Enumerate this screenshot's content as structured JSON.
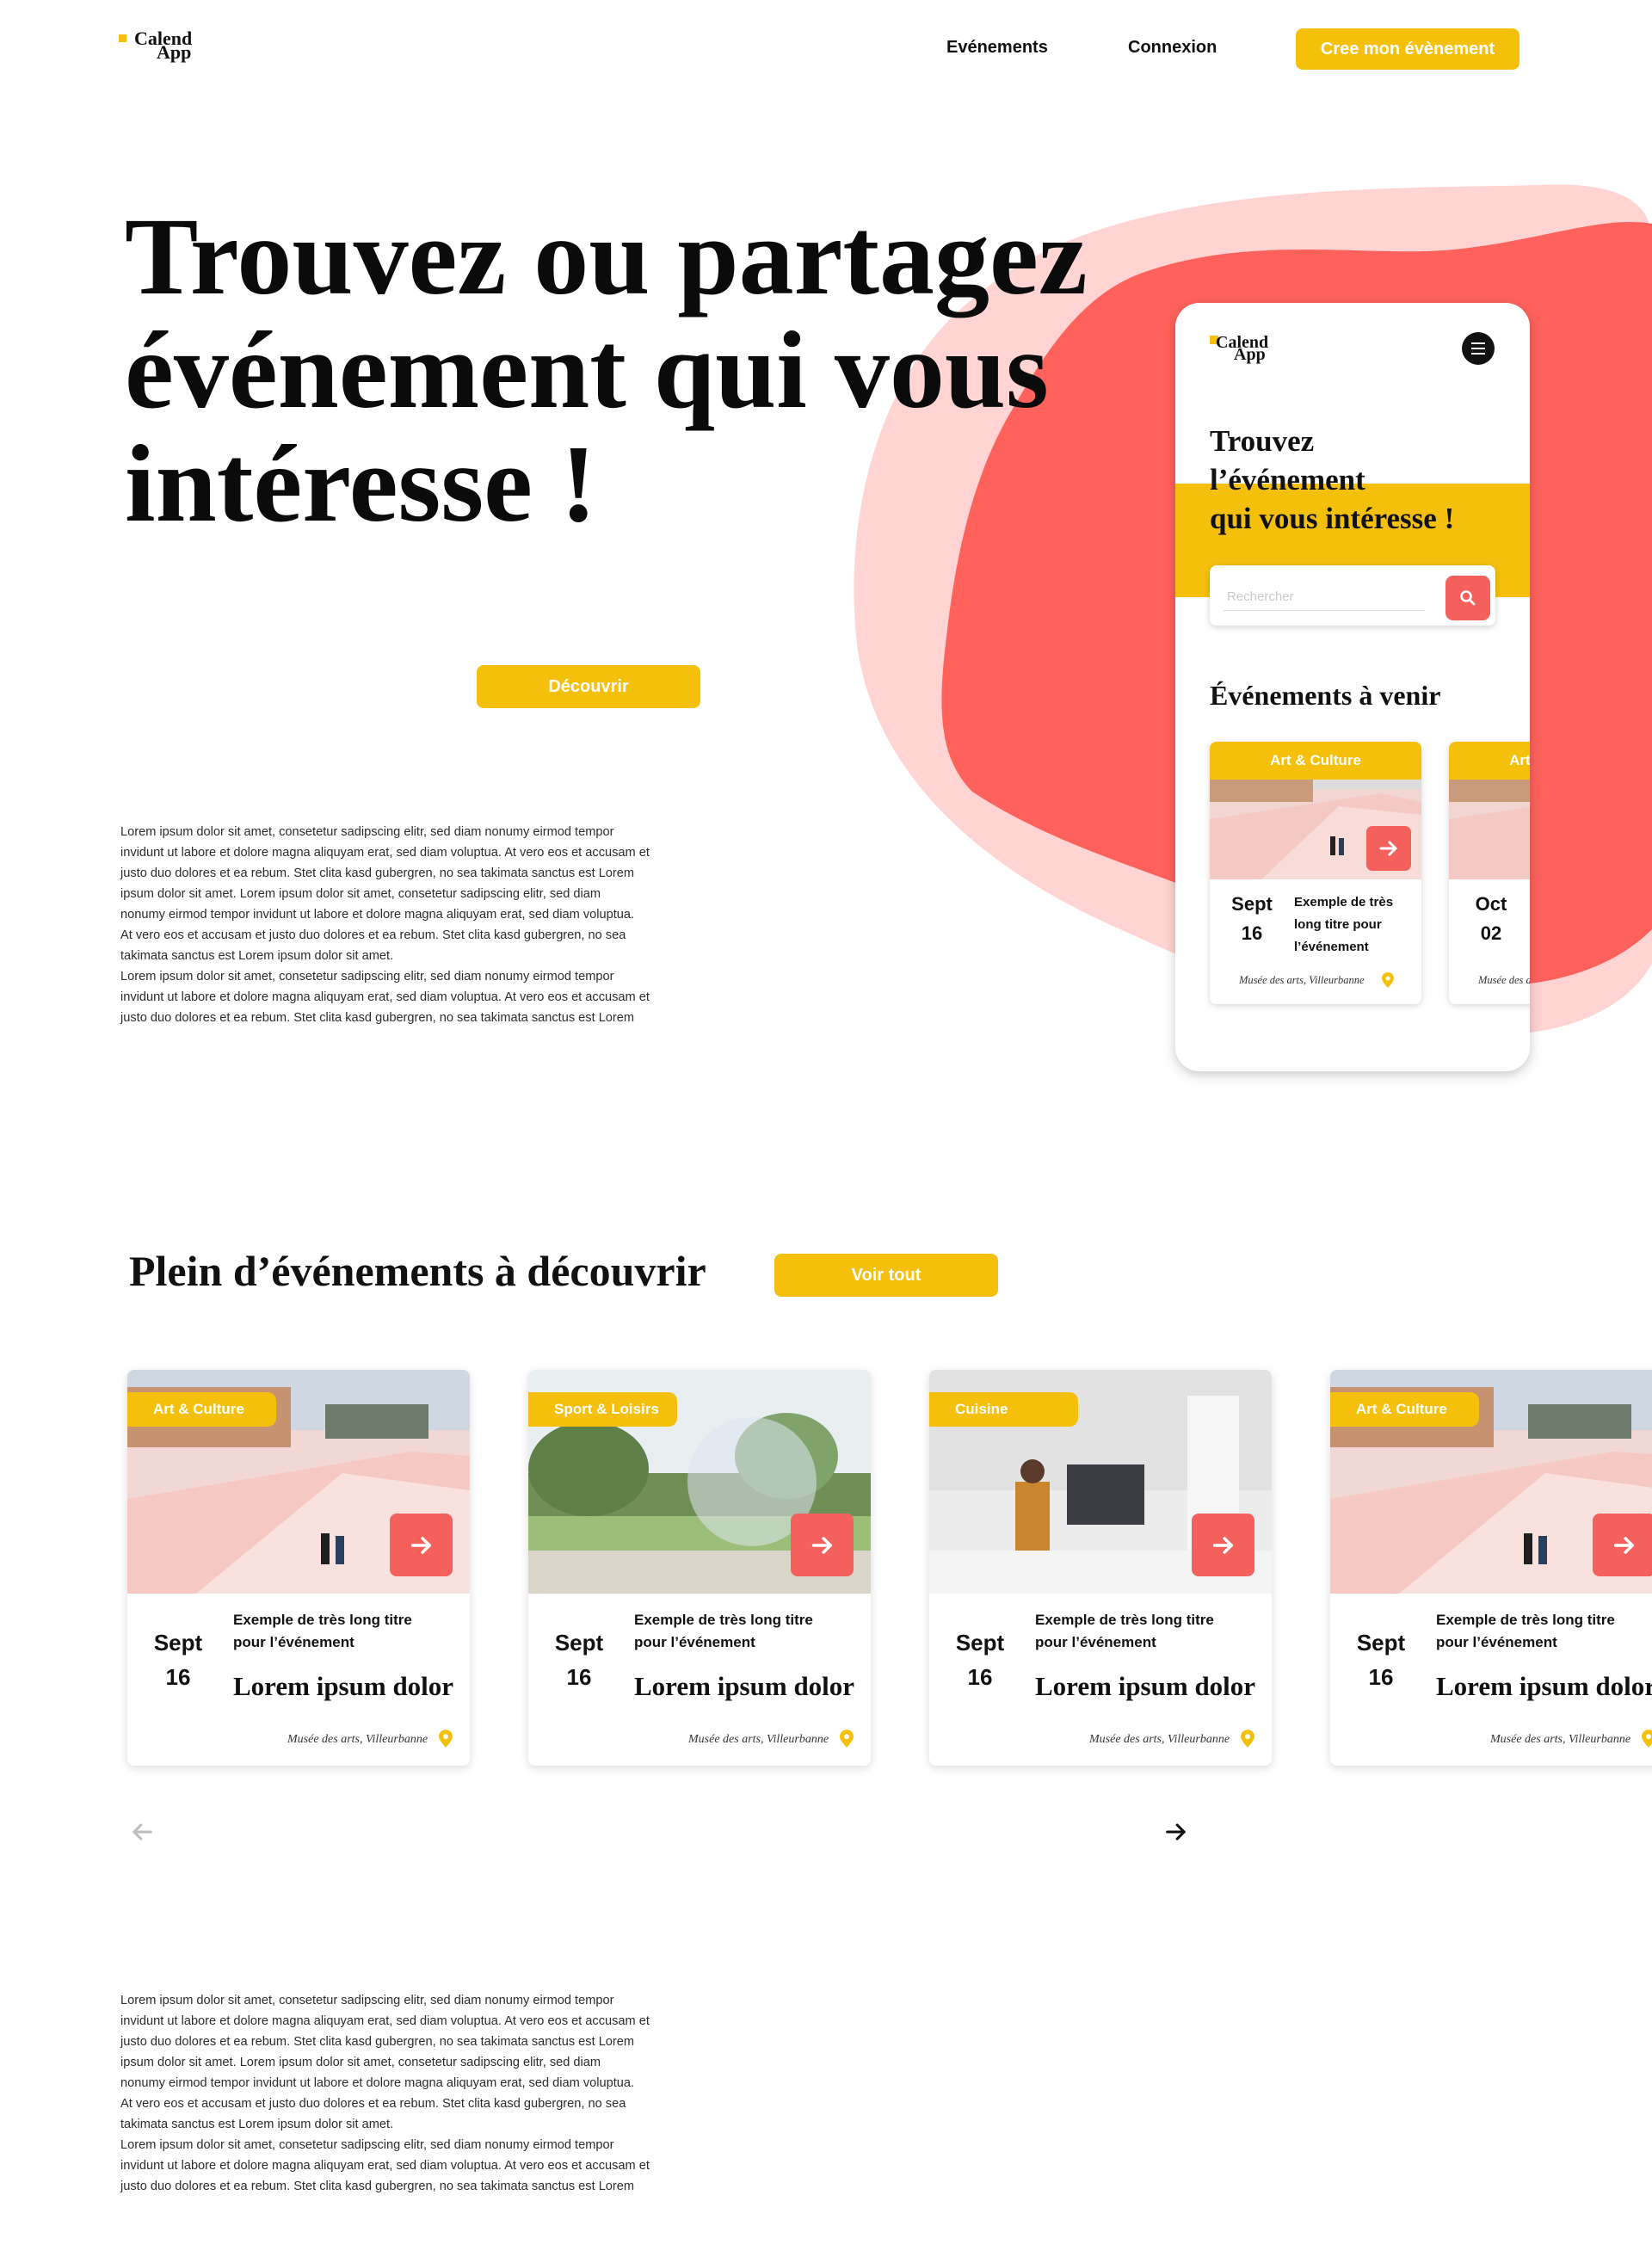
{
  "brand": {
    "line1": "Calend",
    "line2": "App"
  },
  "nav": {
    "events": "Evénements",
    "login": "Connexion",
    "create": "Cree mon évènement"
  },
  "hero": {
    "title": "Trouvez ou partagez événement qui vous intéresse !",
    "discover": "Découvrir",
    "lorem": "Lorem ipsum dolor sit amet, consetetur sadipscing elitr, sed diam nonumy eirmod tempor\ninvidunt ut labore et dolore magna aliquyam erat, sed diam voluptua. At vero eos et accusam et\njusto duo dolores et ea rebum. Stet clita kasd gubergren, no sea takimata sanctus est Lorem\nipsum dolor sit amet. Lorem ipsum dolor sit amet, consetetur sadipscing elitr, sed diam\nnonumy eirmod tempor invidunt ut labore et dolore magna aliquyam erat, sed diam voluptua.\nAt vero eos et accusam et justo duo dolores et ea rebum. Stet clita kasd gubergren, no sea\ntakimata sanctus est Lorem ipsum dolor sit amet.\nLorem ipsum dolor sit amet, consetetur sadipscing elitr, sed diam nonumy eirmod tempor\ninvidunt ut labore et dolore magna aliquyam erat, sed diam voluptua. At vero eos et accusam et\njusto duo dolores et ea rebum. Stet clita kasd gubergren, no sea takimata sanctus est Lorem"
  },
  "phone": {
    "title": "Trouvez\nl’événement\nqui vous intéresse !",
    "search_placeholder": "Rechercher",
    "upcoming": "Événements à venir",
    "cards": [
      {
        "tag": "Art & Culture",
        "month": "Sept",
        "day": "16",
        "title": "Exemple de très\nlong titre pour\nl’événement",
        "place": "Musée des arts, Villeurbanne"
      },
      {
        "tag": "Art & Culture",
        "month": "Oct",
        "day": "02",
        "title": "",
        "place": "Musée des arts"
      }
    ]
  },
  "section": {
    "title": "Plein d’événements à découvrir",
    "see_all": "Voir tout",
    "cards": [
      {
        "tag": "Art & Culture",
        "month": "Sept",
        "day": "16",
        "title": "Exemple de très long titre\npour l’événement",
        "subtitle": "Lorem ipsum dolor",
        "place": "Musée des arts, Villeurbanne"
      },
      {
        "tag": "Sport & Loisirs",
        "month": "Sept",
        "day": "16",
        "title": "Exemple de très long titre\npour l’événement",
        "subtitle": "Lorem ipsum dolor",
        "place": "Musée des arts, Villeurbanne"
      },
      {
        "tag": "Cuisine",
        "month": "Sept",
        "day": "16",
        "title": "Exemple de très long titre\npour l’événement",
        "subtitle": "Lorem ipsum dolor",
        "place": "Musée des arts, Villeurbanne"
      },
      {
        "tag": "Art & Culture",
        "month": "Sept",
        "day": "16",
        "title": "Exemple de très long titre\npour l’événement",
        "subtitle": "Lorem ipsum dolor",
        "place": "Musée des arts, Villeurbanne"
      }
    ],
    "lorem": "Lorem ipsum dolor sit amet, consetetur sadipscing elitr, sed diam nonumy eirmod tempor\ninvidunt ut labore et dolore magna aliquyam erat, sed diam voluptua. At vero eos et accusam et\njusto duo dolores et ea rebum. Stet clita kasd gubergren, no sea takimata sanctus est Lorem\nipsum dolor sit amet. Lorem ipsum dolor sit amet, consetetur sadipscing elitr, sed diam\nnonumy eirmod tempor invidunt ut labore et dolore magna aliquyam erat, sed diam voluptua.\nAt vero eos et accusam et justo duo dolores et ea rebum. Stet clita kasd gubergren, no sea\ntakimata sanctus est Lorem ipsum dolor sit amet.\nLorem ipsum dolor sit amet, consetetur sadipscing elitr, sed diam nonumy eirmod tempor\ninvidunt ut labore et dolore magna aliquyam erat, sed diam voluptua. At vero eos et accusam et\njusto duo dolores et ea rebum. Stet clita kasd gubergren, no sea takimata sanctus est Lorem"
  },
  "icons": {
    "menu": "menu-icon",
    "search": "search-icon",
    "arrow": "arrow-right-icon",
    "pin": "location-pin-icon",
    "prev": "arrow-left-icon",
    "next": "arrow-right-icon"
  },
  "colors": {
    "accent_yellow": "#f5c00c",
    "coral": "#f4615d",
    "blob_light": "#ffd4d3",
    "blob_dark": "#ff625d"
  }
}
